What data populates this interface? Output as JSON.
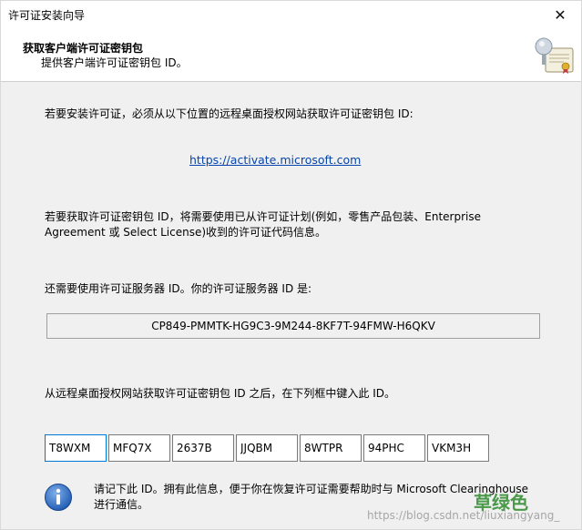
{
  "window": {
    "title": "许可证安装向导",
    "close_glyph": "✕"
  },
  "header": {
    "title": "获取客户端许可证密钥包",
    "subtitle": "提供客户端许可证密钥包 ID。"
  },
  "body": {
    "instruction1": "若要安装许可证，必须从以下位置的远程桌面授权网站获取许可证密钥包 ID:",
    "link": "https://activate.microsoft.com",
    "instruction2_line1": "若要获取许可证密钥包 ID，将需要使用已从许可证计划(例如，零售产品包装、Enterprise",
    "instruction2_line2": "Agreement 或 Select License)收到的许可证代码信息。",
    "server_label": "还需要使用许可证服务器 ID。你的许可证服务器 ID 是:",
    "server_id": "CP849-PMMTK-HG9C3-9M244-8KF7T-94FMW-H6QKV",
    "enter_label": "从远程桌面授权网站获取许可证密钥包 ID 之后，在下列框中键入此 ID。",
    "key_fields": [
      "T8WXM",
      "MFQ7X",
      "2637B",
      "JJQBM",
      "8WTPR",
      "94PHC",
      "VKM3H"
    ],
    "note_line1": "请记下此 ID。拥有此信息，便于你在恢复许可证需要帮助时与 Microsoft Clearinghouse",
    "note_line2": "进行通信。"
  },
  "watermark": {
    "url": "https://blog.csdn.net/liuxiangyang_",
    "stamp": "草绿色"
  },
  "colors": {
    "link": "#0645ad",
    "focus": "#0078d7"
  }
}
